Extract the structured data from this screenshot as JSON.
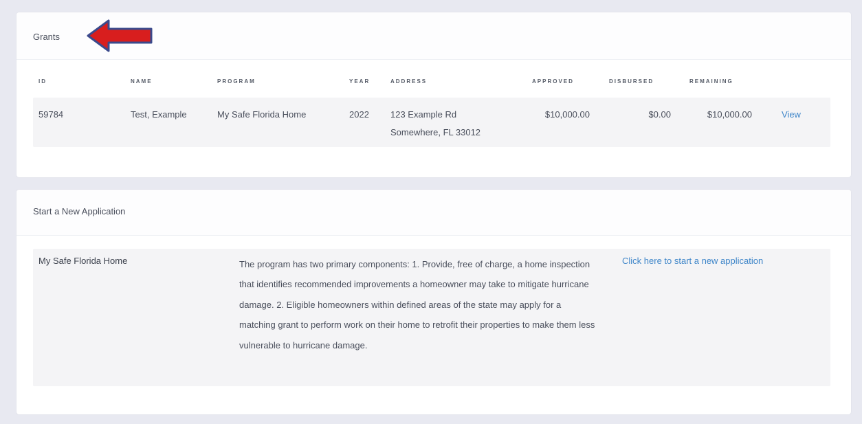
{
  "grants": {
    "title": "Grants",
    "columns": {
      "id": "ID",
      "name": "NAME",
      "program": "PROGRAM",
      "year": "YEAR",
      "address": "ADDRESS",
      "approved": "APPROVED",
      "disbursed": "DISBURSED",
      "remaining": "REMAINING"
    },
    "rows": [
      {
        "id": "59784",
        "name": "Test, Example",
        "program": "My Safe Florida Home",
        "year": "2022",
        "address_line1": "123 Example Rd",
        "address_line2": "Somewhere, FL 33012",
        "approved": "$10,000.00",
        "disbursed": "$0.00",
        "remaining": "$10,000.00",
        "action": "View"
      }
    ]
  },
  "new_application": {
    "title": "Start a New Application",
    "programs": [
      {
        "name": "My Safe Florida Home",
        "description": "The program has two primary components: 1. Provide, free of charge, a home inspection that identifies recommended improvements a homeowner may take to mitigate hurricane damage. 2. Eligible homeowners within defined areas of the state may apply for a matching grant to perform work on their home to retrofit their properties to make them less vulnerable to hurricane damage.",
        "link": "Click here to start a new application"
      }
    ]
  },
  "annotation": {
    "arrow_icon": "left-arrow-icon",
    "arrow_fill": "#d81e1e",
    "arrow_stroke": "#3b4a8c"
  },
  "colors": {
    "page_bg": "#e8e9f1",
    "card_bg": "#ffffff",
    "row_bg": "#f4f4f6",
    "link": "#3f86c9",
    "text": "#4a4f5c"
  }
}
